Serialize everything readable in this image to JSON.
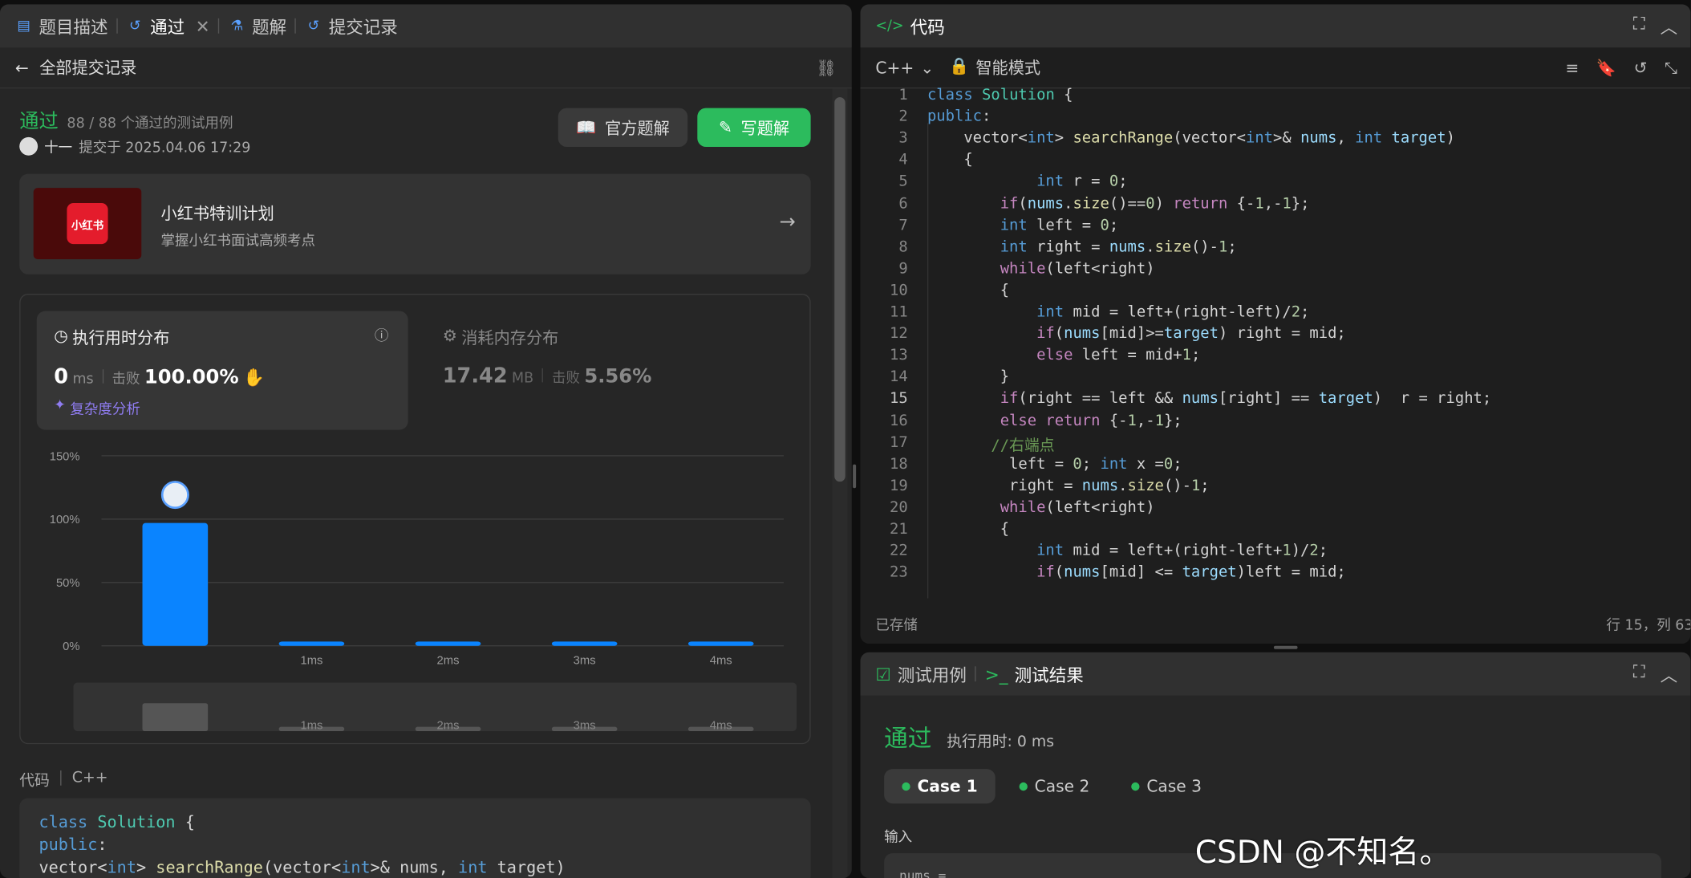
{
  "left_tabs": [
    "题目描述",
    "通过",
    "题解",
    "提交记录"
  ],
  "back_label": "全部提交记录",
  "status": {
    "label": "通过",
    "cases": "88 / 88 个通过的测试用例",
    "user": "十一",
    "submitted": "提交于 2025.04.06 17:29"
  },
  "buttons": {
    "official": "官方题解",
    "write": "写题解"
  },
  "banner": {
    "logo": "小红书",
    "title": "小红书特训计划",
    "subtitle": "掌握小红书面试高频考点"
  },
  "runtime": {
    "title": "执行用时分布",
    "value": "0",
    "unit": "ms",
    "beat_label": "击败",
    "beat": "100.00%",
    "analysis": "复杂度分析"
  },
  "memory": {
    "title": "消耗内存分布",
    "value": "17.42",
    "unit": "MB",
    "beat_label": "击败",
    "beat": "5.56%"
  },
  "chart_data": {
    "type": "bar",
    "categories": [
      "",
      "1ms",
      "2ms",
      "3ms",
      "4ms"
    ],
    "values": [
      97,
      2,
      2,
      2,
      2
    ],
    "ylim": [
      0,
      150
    ],
    "yticks": [
      "150%",
      "100%",
      "50%",
      "0%"
    ],
    "minimap_labels": [
      "1ms",
      "2ms",
      "3ms",
      "4ms"
    ],
    "colors": {
      "bar": "#0a84ff"
    }
  },
  "code_section": {
    "label": "代码",
    "lang": "C++"
  },
  "code_preview": [
    "class Solution {",
    "public:",
    "    vector<int> searchRange(vector<int>& nums, int target)"
  ],
  "editor": {
    "title": "代码",
    "lang": "C++",
    "mode": "智能模式",
    "saved": "已存储",
    "cursor": "行 15，列 63"
  },
  "code_lines": [
    {
      "n": "1",
      "t": "class Solution {"
    },
    {
      "n": "2",
      "t": "public:"
    },
    {
      "n": "3",
      "t": "    vector<int> searchRange(vector<int>& nums, int target)"
    },
    {
      "n": "4",
      "t": "    {"
    },
    {
      "n": "5",
      "t": "            int r = 0;"
    },
    {
      "n": "6",
      "t": "        if(nums.size()==0) return {-1,-1};"
    },
    {
      "n": "7",
      "t": "        int left = 0;"
    },
    {
      "n": "8",
      "t": "        int right = nums.size()-1;"
    },
    {
      "n": "9",
      "t": "        while(left<right)"
    },
    {
      "n": "10",
      "t": "        {"
    },
    {
      "n": "11",
      "t": "            int mid = left+(right-left)/2;"
    },
    {
      "n": "12",
      "t": "            if(nums[mid]>=target) right = mid;"
    },
    {
      "n": "13",
      "t": "            else left = mid+1;"
    },
    {
      "n": "14",
      "t": "        }"
    },
    {
      "n": "15",
      "t": "        if(right == left && nums[right] == target)  r = right;"
    },
    {
      "n": "16",
      "t": "        else return {-1,-1};"
    },
    {
      "n": "17",
      "t": "       //右端点"
    },
    {
      "n": "18",
      "t": "         left = 0; int x =0;"
    },
    {
      "n": "19",
      "t": "         right = nums.size()-1;"
    },
    {
      "n": "20",
      "t": "        while(left<right)"
    },
    {
      "n": "21",
      "t": "        {"
    },
    {
      "n": "22",
      "t": "            int mid = left+(right-left+1)/2;"
    },
    {
      "n": "23",
      "t": "            if(nums[mid] <= target)left = mid;"
    }
  ],
  "bottom": {
    "tab1": "测试用例",
    "tab2": "测试结果",
    "status": "通过",
    "runtime": "执行用时: 0 ms",
    "cases": [
      "Case 1",
      "Case 2",
      "Case 3"
    ],
    "input_label": "输入",
    "input_value": "nums ="
  },
  "watermark": "CSDN @不知名。"
}
